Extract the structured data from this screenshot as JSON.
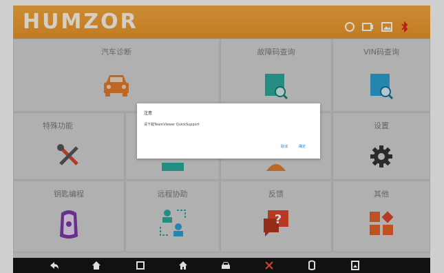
{
  "header": {
    "brand": "HUMZOR",
    "icons": [
      "refresh-icon",
      "camera-icon",
      "gallery-icon",
      "bluetooth-icon"
    ]
  },
  "tiles": [
    {
      "id": "car-diagnosis",
      "label": "汽车诊断",
      "icon": "car-icon"
    },
    {
      "id": "dtc-lookup",
      "label": "故障码查询",
      "icon": "search-book-icon"
    },
    {
      "id": "vin-lookup",
      "label": "VIN码查询",
      "icon": "vin-search-icon"
    },
    {
      "id": "special-functions",
      "label": "特殊功能",
      "icon": "tools-icon"
    },
    {
      "id": "settings",
      "label": "设置",
      "icon": "gear-icon"
    },
    {
      "id": "key-programming",
      "label": "钥匙编程",
      "icon": "key-fob-icon"
    },
    {
      "id": "remote-assist",
      "label": "远程协助",
      "icon": "remote-users-icon"
    },
    {
      "id": "feedback",
      "label": "反馈",
      "icon": "feedback-icon"
    },
    {
      "id": "other",
      "label": "其他",
      "icon": "apps-icon"
    }
  ],
  "dialog": {
    "title": "注意",
    "message": "请下载TeamViewer QuickSupport",
    "cancel_label": "取消",
    "ok_label": "确定"
  },
  "navbar": {
    "icons": [
      "back-icon",
      "home-icon",
      "recent-apps-icon",
      "house-icon",
      "car-nav-icon",
      "tools-nav-icon",
      "key-nav-icon",
      "screenshot-icon"
    ]
  },
  "colors": {
    "header_orange": "#eb9a30",
    "accent_teal": "#2aa89a",
    "accent_red": "#d9442a",
    "accent_purple": "#7b3aa8",
    "dialog_button_blue": "#1e7fd0"
  }
}
